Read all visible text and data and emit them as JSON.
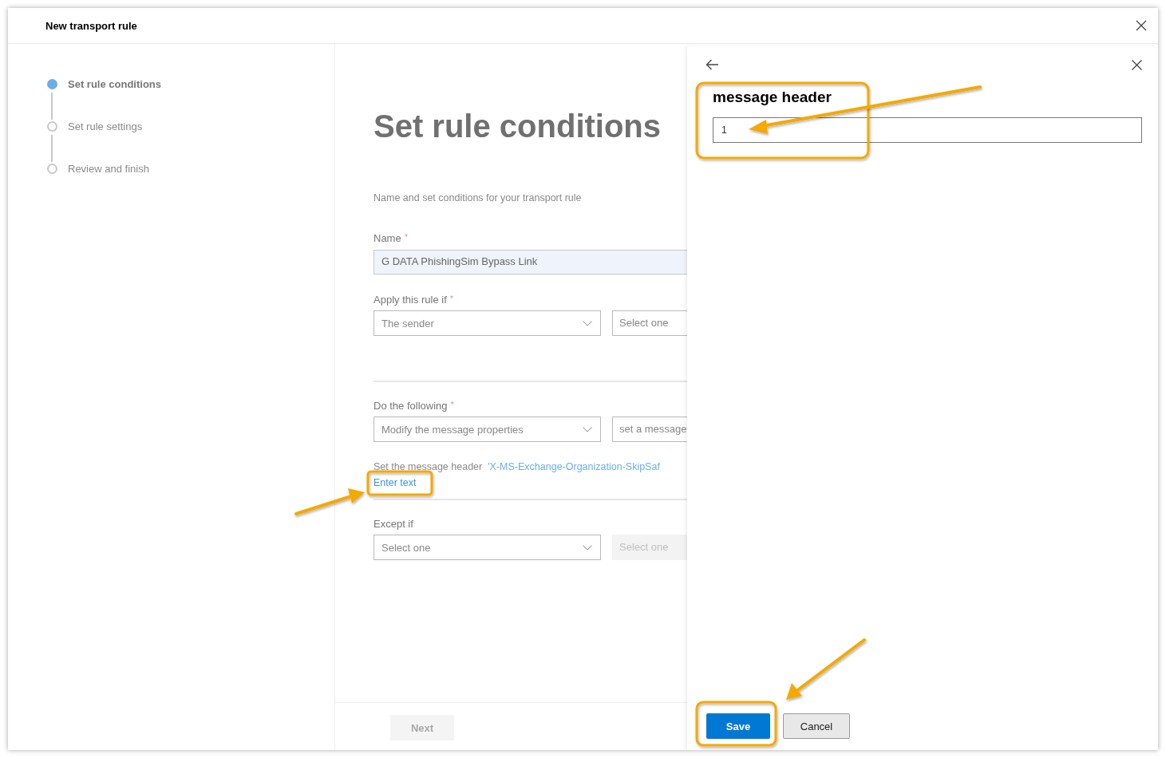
{
  "window": {
    "title": "New transport rule"
  },
  "steps": [
    {
      "label": "Set rule conditions",
      "selected": true
    },
    {
      "label": "Set rule settings",
      "selected": false
    },
    {
      "label": "Review and finish",
      "selected": false
    }
  ],
  "main": {
    "heading": "Set rule conditions",
    "description": "Name and set conditions for your transport rule",
    "name_field": {
      "label": "Name",
      "required_mark": "*",
      "value": "G DATA PhishingSim Bypass Link"
    },
    "sections": [
      {
        "label": "Apply this rule if",
        "required_mark": "*",
        "primary": "The sender",
        "secondary": {
          "text": "Select one",
          "disabled": false
        }
      },
      {
        "label": "Do the following",
        "required_mark": "*",
        "primary": "Modify the message properties",
        "secondary": {
          "text": "set a message",
          "disabled": false
        },
        "note": {
          "text": "Set the message header",
          "link": "'X-MS-Exchange-Organization-SkipSaf",
          "action": "Enter text"
        }
      },
      {
        "label": "Except if",
        "primary": "Select one",
        "secondary": {
          "text": "Select one",
          "disabled": true
        }
      }
    ]
  },
  "footer": {
    "next": {
      "label": "Next",
      "disabled": true
    }
  },
  "panel": {
    "title": "message header",
    "input_value": "1",
    "buttons": [
      {
        "label": "Save",
        "kind": "primary"
      },
      {
        "label": "Cancel",
        "kind": "secondary"
      }
    ]
  }
}
